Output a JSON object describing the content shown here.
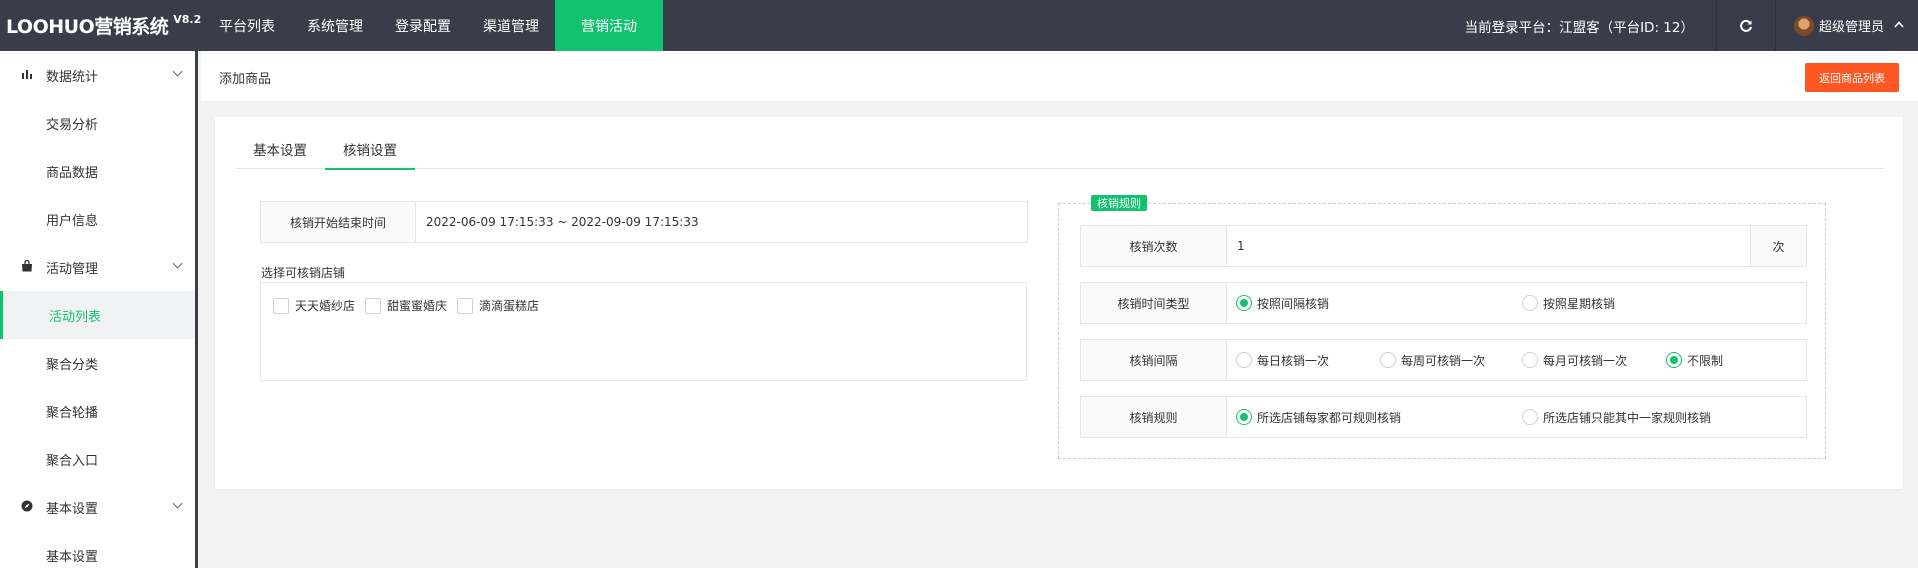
{
  "app": {
    "name": "LOOHUO营销系统",
    "version": "V8.2"
  },
  "topnav": {
    "items": [
      {
        "label": "平台列表",
        "active": false
      },
      {
        "label": "系统管理",
        "active": false
      },
      {
        "label": "登录配置",
        "active": false
      },
      {
        "label": "渠道管理",
        "active": false
      },
      {
        "label": "营销活动",
        "active": true
      }
    ]
  },
  "header": {
    "platform_text": "当前登录平台：江盟客（平台ID: 12）",
    "refresh_icon": "refresh-icon",
    "user_name": "超级管理员"
  },
  "sidebar": {
    "groups": [
      {
        "label": "数据统计",
        "icon": "bar-chart-icon",
        "items": [
          "交易分析",
          "商品数据",
          "用户信息"
        ]
      },
      {
        "label": "活动管理",
        "icon": "bag-icon",
        "items": [
          "活动列表",
          "聚合分类",
          "聚合轮播",
          "聚合入口"
        ]
      },
      {
        "label": "基本设置",
        "icon": "compass-icon",
        "items": [
          "基本设置"
        ]
      }
    ],
    "active_item": "活动列表"
  },
  "page": {
    "title": "添加商品",
    "back_button": "返回商品列表"
  },
  "tabs": [
    {
      "label": "基本设置",
      "active": false
    },
    {
      "label": "核销设置",
      "active": true
    }
  ],
  "left": {
    "time_label": "核销开始结束时间",
    "time_value": "2022-06-09 17:15:33 ~ 2022-09-09 17:15:33",
    "store_caption": "选择可核销店铺",
    "stores": [
      "天天婚纱店",
      "甜蜜蜜婚庆",
      "滴滴蛋糕店"
    ]
  },
  "rules": {
    "legend": "核销规则",
    "count": {
      "label": "核销次数",
      "value": "1",
      "suffix": "次"
    },
    "time_type": {
      "label": "核销时间类型",
      "options": [
        "按照间隔核销",
        "按照星期核销"
      ],
      "selected": "按照间隔核销"
    },
    "interval": {
      "label": "核销间隔",
      "options": [
        "每日核销一次",
        "每周可核销一次",
        "每月可核销一次",
        "不限制"
      ],
      "selected": "不限制"
    },
    "rule": {
      "label": "核销规则",
      "options": [
        "所选店铺每家都可规则核销",
        "所选店铺只能其中一家规则核销"
      ],
      "selected": "所选店铺每家都可规则核销"
    }
  },
  "colors": {
    "accent": "#13c26e",
    "topbar": "#393d49",
    "danger": "#ff5722"
  }
}
